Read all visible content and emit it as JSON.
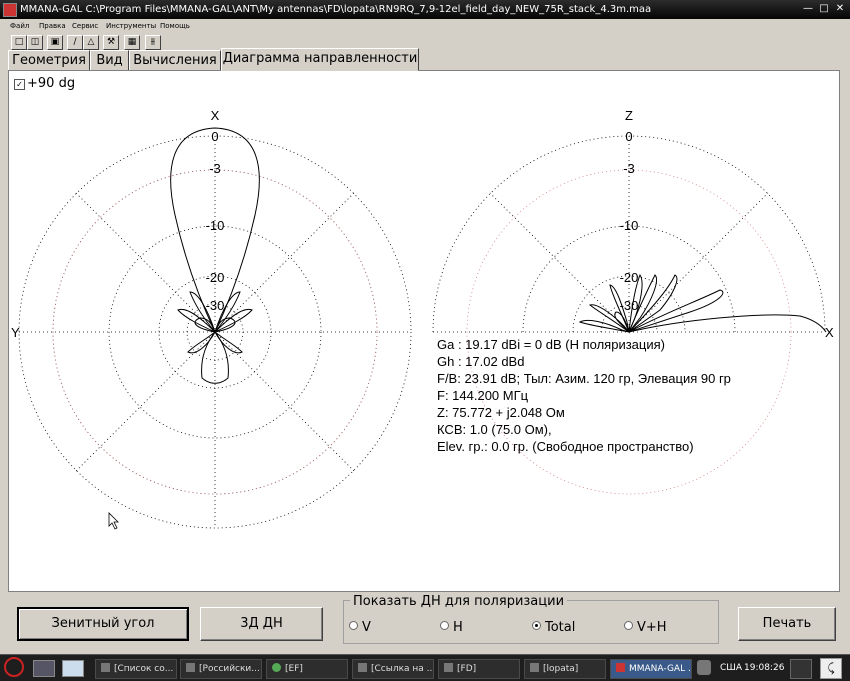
{
  "window": {
    "title": "MMANA-GAL C:\\Program Files\\MMANA-GAL\\ANT\\My antennas\\FD\\lopata\\RN9RQ_7,9-12el_field_day_NEW_75R_stack_4.3m.maa"
  },
  "menu": [
    "Файл",
    "Правка",
    "Сервис",
    "Инструменты",
    "Помощь"
  ],
  "tabs": [
    "Геометрия",
    "Вид",
    "Вычисления",
    "Диаграмма направленности"
  ],
  "active_tab": 3,
  "checkbox": {
    "label": "+90 dg",
    "checked": true
  },
  "left_plot": {
    "top_label": "X",
    "left_label": "Y",
    "ring_labels": [
      "0",
      "-3",
      "-10",
      "-20",
      "-30"
    ]
  },
  "right_plot": {
    "top_label": "Z",
    "right_label": "X",
    "ring_labels": [
      "0",
      "-3",
      "-10",
      "-20",
      "-30"
    ]
  },
  "info": {
    "ga": "Ga : 19.17 dBi = 0 dB  (H поляризация)",
    "gh": "Gh : 17.02 dBd",
    "fb": "F/B: 23.91 dB; Тыл: Азим. 120 гр, Элевация 90 гр",
    "f": "F: 144.200 МГц",
    "z": "Z: 75.772 + j2.048 Ом",
    "swr": "КСВ: 1.0 (75.0 Ом),",
    "elev": "Elev. гр.: 0.0 гр. (Свободное пространство)"
  },
  "buttons": {
    "zenith": "Зенитный угол",
    "pattern3d": "3Д   ДН",
    "print": "Печать"
  },
  "polarization": {
    "title": "Показать ДН для поляризации",
    "options": [
      "V",
      "H",
      "Total",
      "V+H"
    ],
    "selected": "Total"
  },
  "taskbar": {
    "items": [
      "[Список со...",
      "[Российски...",
      "[EF]",
      "[Ссылка на ...",
      "[FD]",
      "[lopata]",
      "MMANA-GAL ..."
    ],
    "lang": "США",
    "time": "19:08:26"
  }
}
